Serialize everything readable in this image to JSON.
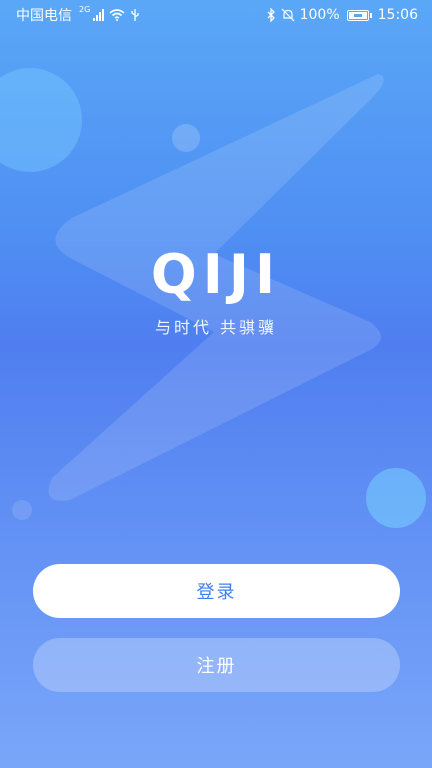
{
  "status_bar": {
    "carrier": "中国电信",
    "network_tag": "2G",
    "battery": "100%",
    "time": "15:06"
  },
  "brand": {
    "logo": "QIJI",
    "tagline": "与时代 共骐骥"
  },
  "actions": {
    "login_label": "登录",
    "register_label": "注册"
  },
  "colors": {
    "accent": "#3d7ff0",
    "background_top": "#5aa7f7",
    "background_bottom": "#7aa6f9"
  }
}
